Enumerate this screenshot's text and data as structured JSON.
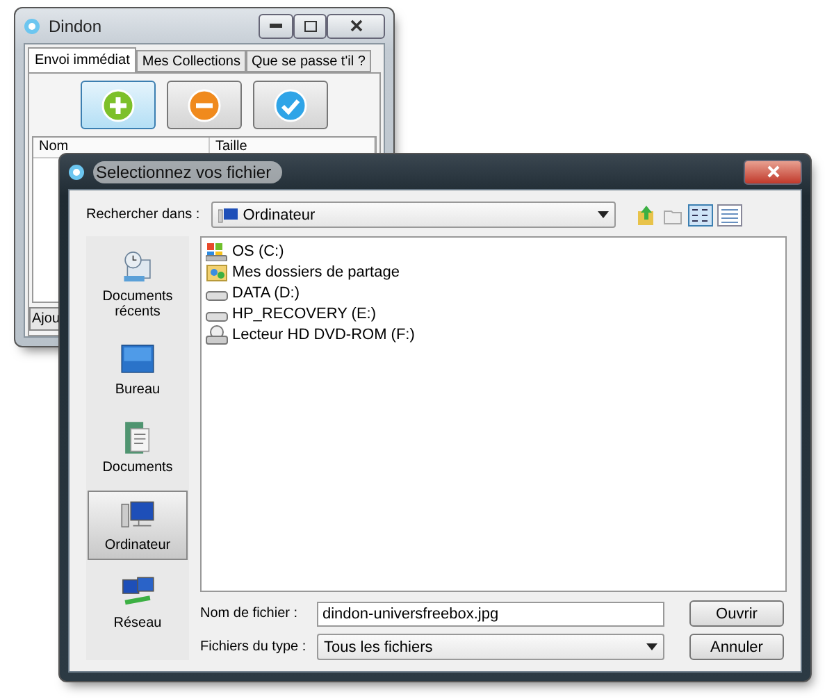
{
  "background_window": {
    "title": "Dindon",
    "tabs": [
      {
        "label": "Envoi immédiat",
        "selected": true
      },
      {
        "label": "Mes Collections",
        "selected": false
      },
      {
        "label": "Que se passe t'il ?",
        "selected": false
      }
    ],
    "toolbar_buttons": [
      {
        "kind": "add",
        "highlighted": true
      },
      {
        "kind": "remove",
        "highlighted": false
      },
      {
        "kind": "confirm",
        "highlighted": false
      }
    ],
    "table": {
      "columns": [
        "Nom",
        "Taille"
      ]
    },
    "footer_button": "Ajou"
  },
  "dialog": {
    "title": "Selectionnez vos fichier",
    "look_in_label": "Rechercher dans :",
    "look_in_value": "Ordinateur",
    "places": [
      {
        "label": "Documents récents",
        "kind": "recent",
        "selected": false
      },
      {
        "label": "Bureau",
        "kind": "desktop",
        "selected": false
      },
      {
        "label": "Documents",
        "kind": "documents",
        "selected": false
      },
      {
        "label": "Ordinateur",
        "kind": "computer",
        "selected": true
      },
      {
        "label": "Réseau",
        "kind": "network",
        "selected": false
      }
    ],
    "files": [
      {
        "name": "OS (C:)",
        "kind": "system-drive"
      },
      {
        "name": "Mes dossiers de partage",
        "kind": "shared"
      },
      {
        "name": "DATA (D:)",
        "kind": "drive"
      },
      {
        "name": "HP_RECOVERY (E:)",
        "kind": "drive"
      },
      {
        "name": "Lecteur HD DVD-ROM (F:)",
        "kind": "optical"
      }
    ],
    "filename_label": "Nom de fichier :",
    "filename_value": "dindon-universfreebox.jpg",
    "filetype_label": "Fichiers du type :",
    "filetype_value": "Tous les fichiers",
    "buttons": [
      "Ouvrir",
      "Annuler"
    ]
  }
}
